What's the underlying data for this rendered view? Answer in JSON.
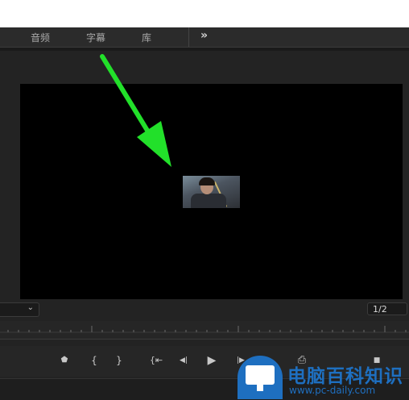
{
  "tabs": [
    {
      "label": "音频"
    },
    {
      "label": "字幕"
    },
    {
      "label": "库"
    }
  ],
  "overflow_label": "»",
  "zoom": {
    "value": "",
    "chevron": "⌄"
  },
  "resolution": {
    "value": "1/2"
  },
  "transport": {
    "add_marker": "⬟",
    "mark_in": "{",
    "mark_out": "}",
    "go_to_in": "{⇤",
    "step_back": "◀|",
    "play": "▶",
    "step_forward": "|▶",
    "export_frame": "⎙",
    "settings": "■"
  },
  "annotation": {
    "arrow_color": "#22e02a"
  },
  "watermark": {
    "title": "电脑百科知识",
    "url": "www.pc-daily.com",
    "color": "#1e6fc0"
  }
}
